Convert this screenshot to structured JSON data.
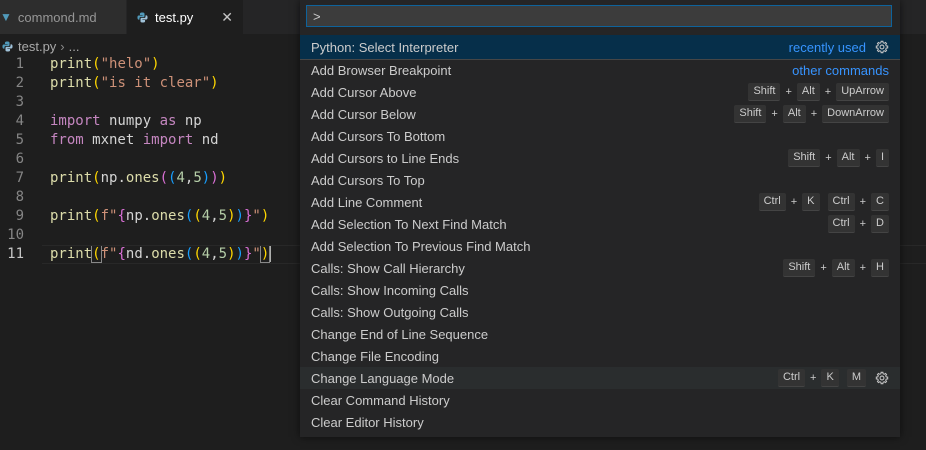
{
  "tabs": [
    {
      "label": "commond.md",
      "active": false
    },
    {
      "label": "test.py",
      "active": true
    }
  ],
  "breadcrumb": {
    "file": "test.py",
    "more": "..."
  },
  "editor": {
    "line_numbers": [
      "1",
      "2",
      "3",
      "4",
      "5",
      "6",
      "7",
      "8",
      "9",
      "10",
      "11"
    ],
    "lines": [
      "print(\"helo\")",
      "print(\"is it clear\")",
      "",
      "import numpy as np",
      "from mxnet import nd",
      "",
      "print(np.ones((4,5)))",
      "",
      "print(f\"{np.ones((4,5))}\")",
      "",
      "print(f\"{nd.ones((4,5))}\")"
    ]
  },
  "palette": {
    "input_value": ">",
    "items": [
      {
        "label": "Python: Select Interpreter",
        "meta": "recently used",
        "gear": true,
        "selected": true
      },
      {
        "label": "Add Browser Breakpoint",
        "meta": "other commands"
      },
      {
        "label": "Add Cursor Above",
        "keys": [
          [
            "Shift",
            "Alt",
            "UpArrow"
          ]
        ]
      },
      {
        "label": "Add Cursor Below",
        "keys": [
          [
            "Shift",
            "Alt",
            "DownArrow"
          ]
        ]
      },
      {
        "label": "Add Cursors To Bottom"
      },
      {
        "label": "Add Cursors to Line Ends",
        "keys": [
          [
            "Shift",
            "Alt",
            "I"
          ]
        ]
      },
      {
        "label": "Add Cursors To Top"
      },
      {
        "label": "Add Line Comment",
        "keys": [
          [
            "Ctrl",
            "K"
          ],
          [
            "Ctrl",
            "C"
          ]
        ]
      },
      {
        "label": "Add Selection To Next Find Match",
        "keys": [
          [
            "Ctrl",
            "D"
          ]
        ]
      },
      {
        "label": "Add Selection To Previous Find Match"
      },
      {
        "label": "Calls: Show Call Hierarchy",
        "keys": [
          [
            "Shift",
            "Alt",
            "H"
          ]
        ]
      },
      {
        "label": "Calls: Show Incoming Calls"
      },
      {
        "label": "Calls: Show Outgoing Calls"
      },
      {
        "label": "Change End of Line Sequence"
      },
      {
        "label": "Change File Encoding"
      },
      {
        "label": "Change Language Mode",
        "keys": [
          [
            "Ctrl",
            "K"
          ],
          [
            "M"
          ]
        ],
        "gear": true,
        "hovered": true
      },
      {
        "label": "Clear Command History"
      },
      {
        "label": "Clear Editor History"
      }
    ]
  },
  "colors": {
    "accent": "#3794ff",
    "selected_bg": "#062f4a",
    "focus_border": "#0e639c"
  }
}
